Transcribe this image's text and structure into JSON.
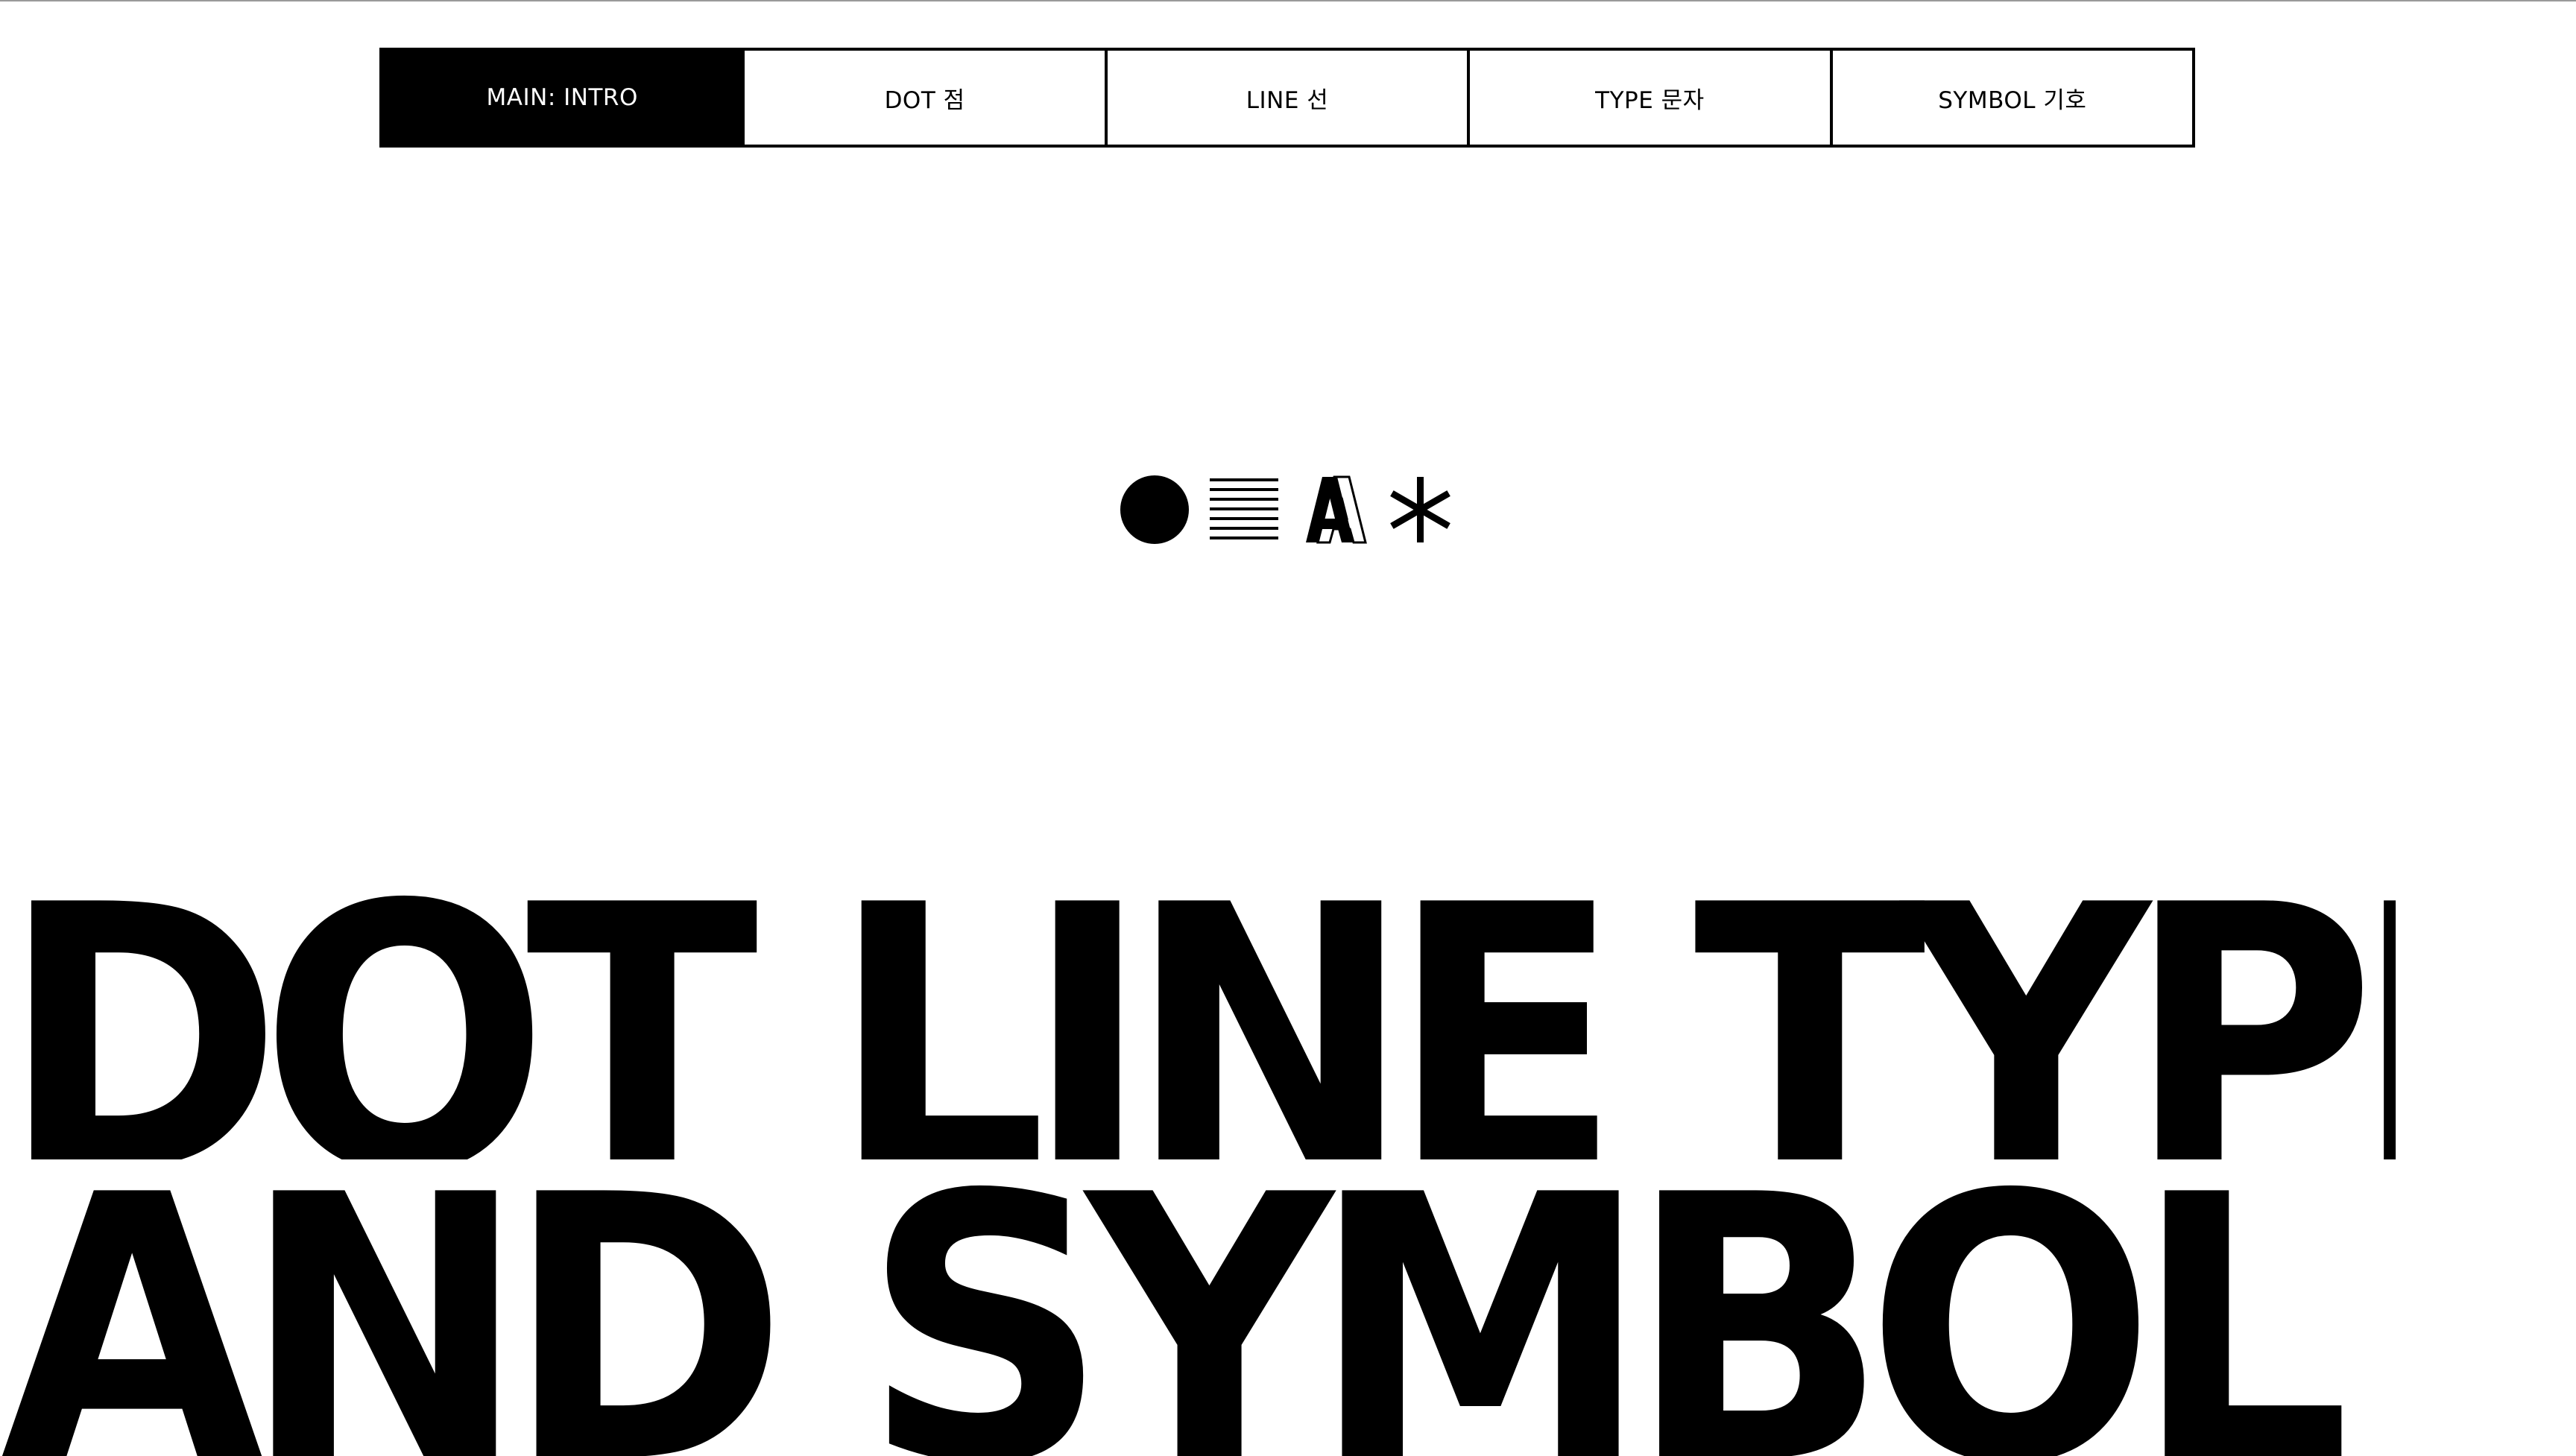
{
  "nav": {
    "tabs": [
      {
        "label": "MAIN: INTRO",
        "active": true
      },
      {
        "label": "DOT 점",
        "active": false
      },
      {
        "label": "LINE 선",
        "active": false
      },
      {
        "label": "TYPE 문자",
        "active": false
      },
      {
        "label": "SYMBOL 기호",
        "active": false
      }
    ]
  },
  "logo": {
    "icons": [
      "dot-icon",
      "lines-icon",
      "type-a-icon",
      "asterisk-icon"
    ]
  },
  "headline": {
    "line1": "DOT LINE TYPE",
    "line2": "AND SYMBOL"
  },
  "colors": {
    "foreground": "#000000",
    "background": "#ffffff",
    "active_tab_text": "#ffffff"
  }
}
